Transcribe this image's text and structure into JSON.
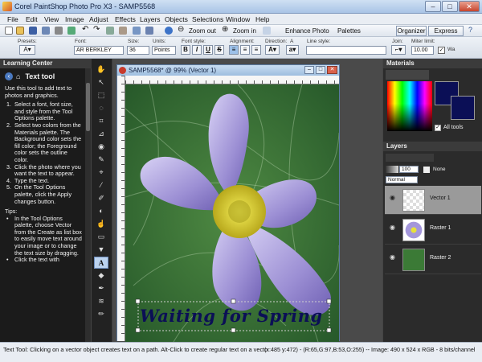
{
  "window": {
    "title": "Corel PaintShop Photo Pro X3 - SAMP5568",
    "min": "–",
    "max": "□",
    "close": "✕"
  },
  "menu": [
    "File",
    "Edit",
    "View",
    "Image",
    "Adjust",
    "Effects",
    "Layers",
    "Objects",
    "Selections",
    "Window",
    "Help"
  ],
  "toolbar": {
    "zoom_out": "Zoom out",
    "zoom_in": "Zoom in",
    "enhance_photo": "Enhance Photo",
    "palettes": "Palettes",
    "organizer": "Organizer",
    "express_lab": "Express Lab"
  },
  "options": {
    "presets_label": "Presets:",
    "font_label": "Font:",
    "font_value": "AR BERKLEY",
    "size_label": "Size:",
    "size_value": "36",
    "units_label": "Units:",
    "units_value": "Points",
    "style_label": "Font style:",
    "bold": "B",
    "italic": "I",
    "underline": "U",
    "strike": "S",
    "alignment_label": "Alignment:",
    "direction_label": "Direction:",
    "anti_label": "A",
    "line_style_label": "Line style:",
    "join_label": "Join:",
    "miter_label": "Miter limit:",
    "miter_value": "10.00",
    "warp_label": "Wa"
  },
  "learning_center": {
    "title": "Learning Center",
    "tool_title": "Text tool",
    "intro": "Use this tool to add text to photos and graphics.",
    "steps": [
      "Select a font, font size, and style from the Tool Options palette.",
      "Select two colors from the Materials palette. The Background color sets the fill color; the Foreground color sets the outline color.",
      "Click the photo where you want the text to appear.",
      "Type the text.",
      "On the Tool Options palette, click the Apply changes button."
    ],
    "tips_label": "Tips:",
    "tips": [
      "In the Tool Options palette, choose Vector from the Create as list box to easily move text around your image or to change the text size by dragging.",
      "Click the text with"
    ]
  },
  "document": {
    "title": "SAMP5568* @ 99% (Vector 1)",
    "overlay_text": "Waiting for Spring"
  },
  "materials": {
    "title": "Materials",
    "all_tools": "All tools",
    "fg_color": "#0b0f56",
    "bg_color": "#0b0f56"
  },
  "layers": {
    "title": "Layers",
    "opacity": "100",
    "blend_mode": "Normal",
    "none_label": "None",
    "items": [
      {
        "name": "Vector 1"
      },
      {
        "name": "Raster 1"
      },
      {
        "name": "Raster 2"
      }
    ]
  },
  "status": {
    "left": "Text Tool: Clicking on a vector object creates text on a path. Alt-Click to create regular text on a vecto",
    "right": "(x:485 y:472) - (R:65,G:97,B:53,O:255) -- Image: 490 x 524 x RGB - 8 bits/channel"
  }
}
